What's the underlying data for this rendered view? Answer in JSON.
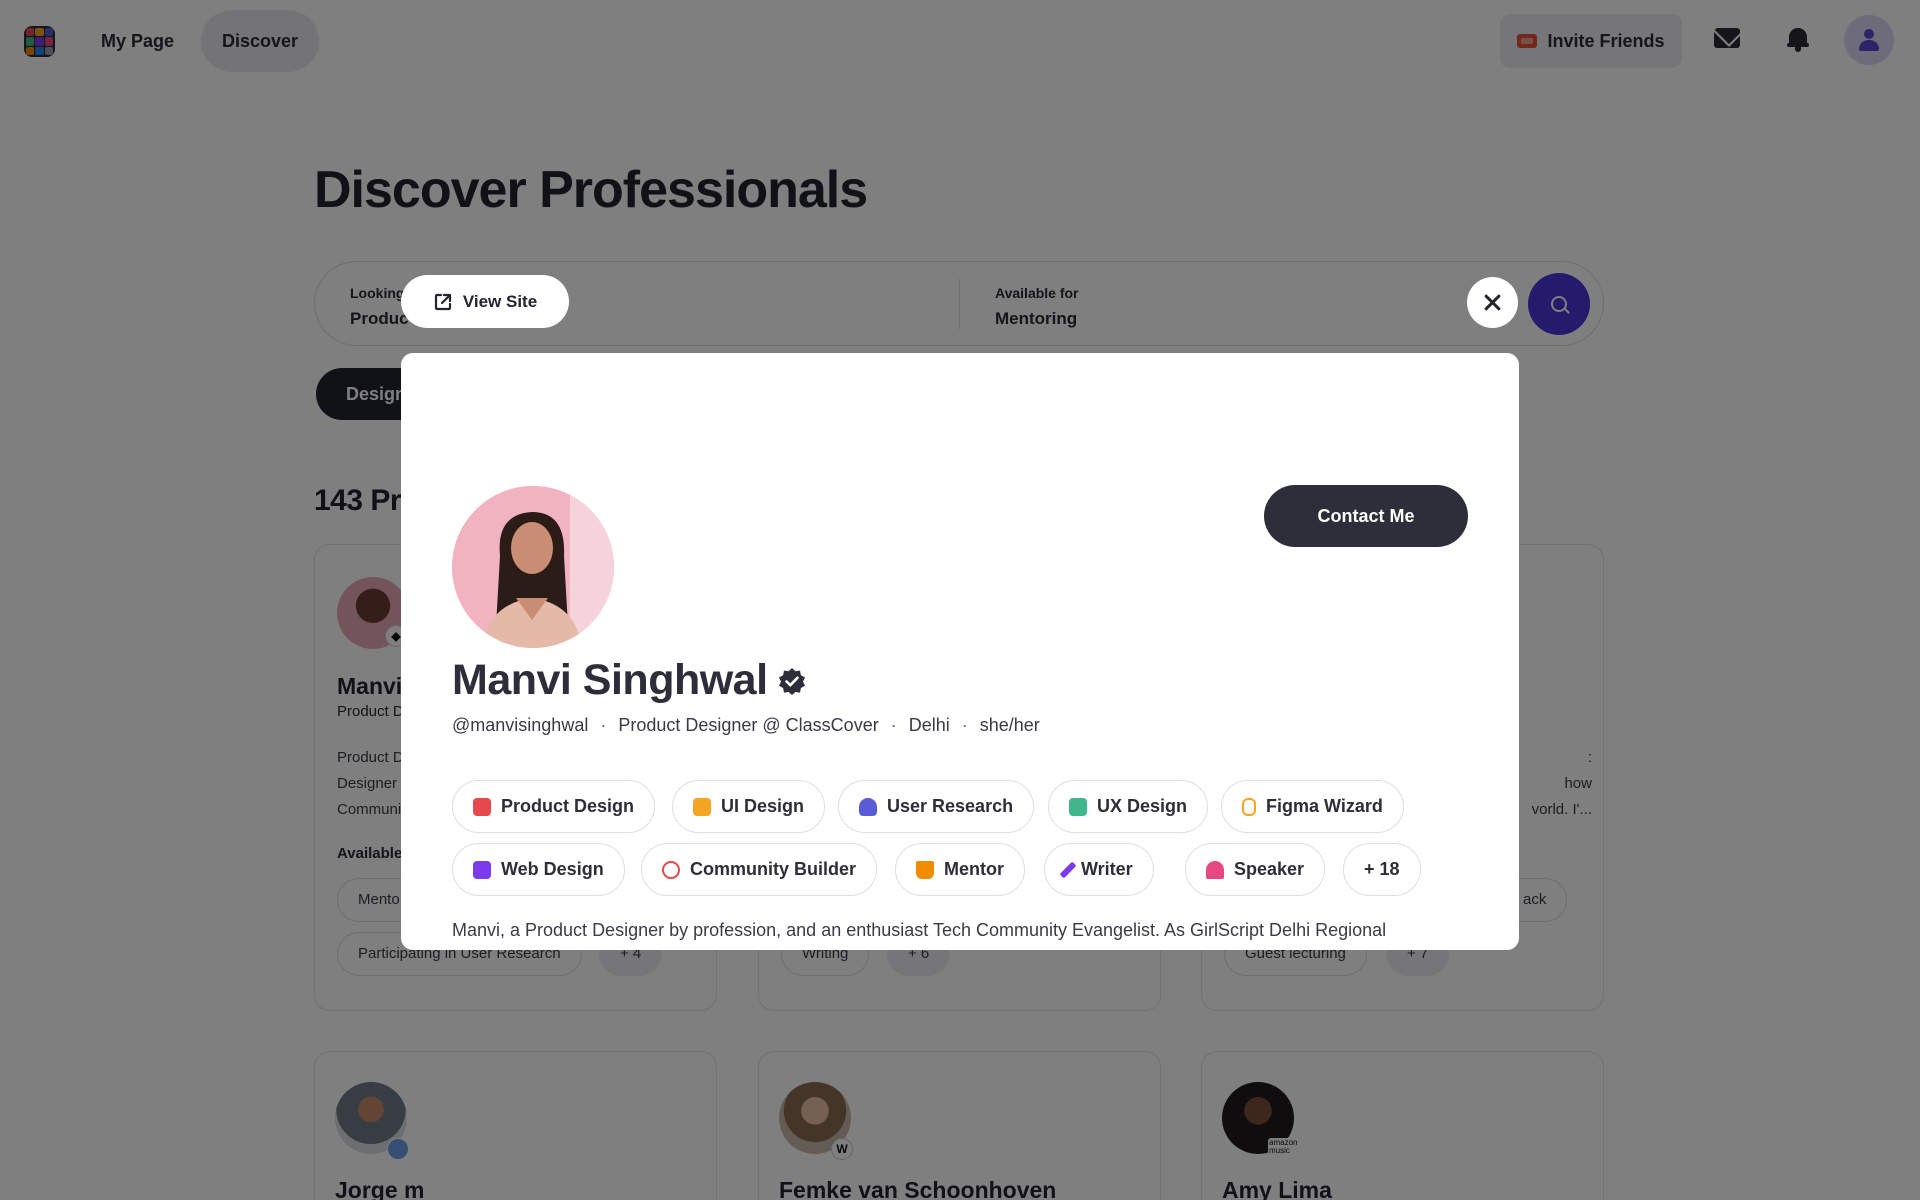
{
  "nav": {
    "my_page": "My Page",
    "discover": "Discover",
    "invite": "Invite Friends"
  },
  "page": {
    "title": "Discover Professionals",
    "search": {
      "looking_label": "Looking",
      "looking_value": "Produc",
      "available_label": "Available for",
      "available_value": "Mentoring"
    },
    "active_filter": "Design",
    "results_count": "143 Pr"
  },
  "cards": [
    {
      "name": "Manvi",
      "role": "Product D",
      "bio": [
        "Product D",
        "Designer",
        "Communi"
      ],
      "available_label": "Available",
      "pills": [
        "Mento",
        "Participating in User Research",
        "+ 4"
      ]
    },
    {
      "pills": [
        "Writing",
        "+ 6"
      ]
    },
    {
      "bio": [
        ":",
        "how",
        "vorld. I'..."
      ],
      "pills": [
        "ack",
        "Guest lecturing",
        "+ 7"
      ]
    }
  ],
  "bottom_cards": [
    {
      "name": "Jorge m"
    },
    {
      "name": "Femke van Schoonhoven",
      "badge": "W"
    },
    {
      "name": "Amy Lima",
      "badge": "amazon music"
    }
  ],
  "modal": {
    "view_site": "View Site",
    "contact": "Contact Me",
    "name": "Manvi Singhwal",
    "meta": {
      "handle": "@manvisinghwal",
      "role": "Product Designer @ ClassCover",
      "location": "Delhi",
      "pronouns": "she/her",
      "separator": "·"
    },
    "tags": [
      {
        "label": "Product Design",
        "color": "#e5484d"
      },
      {
        "label": "UI Design",
        "color": "#f5a524"
      },
      {
        "label": "User Research",
        "color": "#5b5bd6"
      },
      {
        "label": "UX Design",
        "color": "#3fb68b"
      },
      {
        "label": "Figma Wizard",
        "color": "#f5a524"
      },
      {
        "label": "Web Design",
        "color": "#7c3aed"
      },
      {
        "label": "Community Builder",
        "color": "#e5484d"
      },
      {
        "label": "Mentor",
        "color": "#f08c00"
      },
      {
        "label": "Writer",
        "color": "#7c3aed"
      },
      {
        "label": "Speaker",
        "color": "#e64980"
      },
      {
        "label": "+ 18",
        "color": ""
      }
    ],
    "about": "Manvi, a Product Designer by profession, and an enthusiast Tech Community Evangelist. As GirlScript Delhi Regional"
  },
  "colors": {
    "accent": "#4b36d8",
    "dark": "#2d2e3a",
    "overlay": "rgba(0,0,0,0.5)"
  }
}
